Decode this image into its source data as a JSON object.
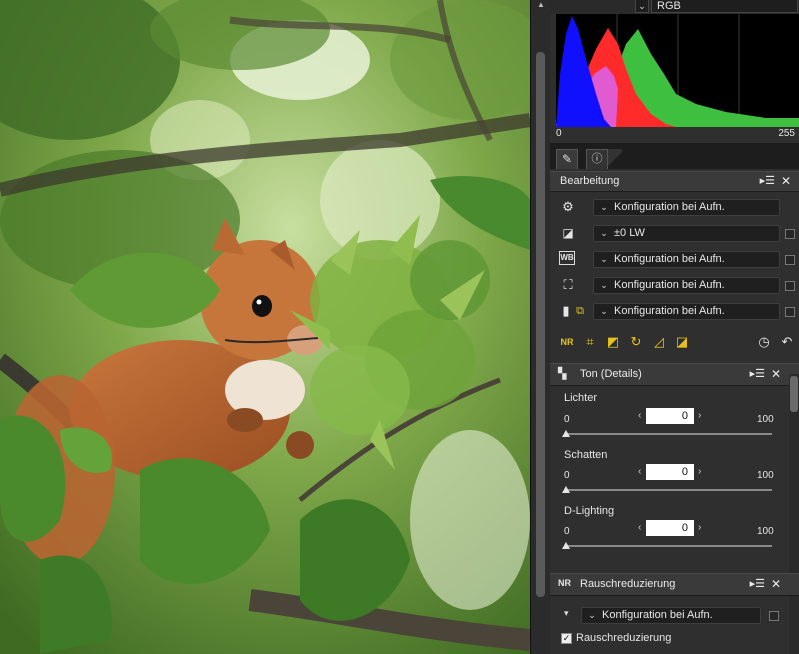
{
  "histogram": {
    "channel": "RGB",
    "axis_min": "0",
    "axis_max": "255",
    "colors": {
      "blue": "#1010ff",
      "red": "#ff2a2a",
      "magenta": "#e05ad0",
      "green": "#3fbf3f",
      "yellow": "#ffff10",
      "white": "#eeeeee"
    }
  },
  "tabs": [
    {
      "name": "edit-tab",
      "icon": "edit-icon"
    },
    {
      "name": "info-tab",
      "icon": "info-icon"
    }
  ],
  "edit_panel": {
    "title": "Bearbeitung",
    "menu_icon": "▸☰",
    "rows": [
      {
        "icon": "gear-icon",
        "glyph": "⚙",
        "value": "Konfiguration bei Aufn.",
        "checkbox": false
      },
      {
        "icon": "exposure-icon",
        "glyph": "◪",
        "value": "±0 LW",
        "checkbox": true
      },
      {
        "icon": "white-balance-icon",
        "glyph": "WB",
        "value": "Konfiguration bei Aufn.",
        "checkbox": true
      },
      {
        "icon": "picture-control-icon",
        "glyph": "⛶",
        "value": "Konfiguration bei Aufn.",
        "checkbox": true
      },
      {
        "icon": "active-d-lighting-icon",
        "glyph": "▮",
        "value": "Konfiguration bei Aufn.",
        "checkbox": true
      }
    ],
    "toolbar": [
      "noise-reduction-tool-icon",
      "crop-tool-icon",
      "straighten-tool-icon",
      "rotate-tool-icon",
      "perspective-tool-icon",
      "levels-tool-icon"
    ],
    "toolbar_glyphs": [
      "NR",
      "⌗",
      "◩",
      "↻",
      "◿",
      "◪"
    ],
    "history_icon": "history-icon",
    "undo_icon": "undo-icon"
  },
  "tone_panel": {
    "title": "Ton (Details)",
    "sliders": [
      {
        "label": "Lichter",
        "min": "0",
        "max": "100",
        "value": "0",
        "fraction": 0
      },
      {
        "label": "Schatten",
        "min": "0",
        "max": "100",
        "value": "0",
        "fraction": 0
      },
      {
        "label": "D-Lighting",
        "min": "0",
        "max": "100",
        "value": "0",
        "fraction": 0
      }
    ]
  },
  "noise_panel": {
    "title": "Rauschreduzierung",
    "value": "Konfiguration bei Aufn.",
    "checkbox_label": "Rauschreduzierung",
    "checkbox_checked": true
  },
  "ui_glyphs": {
    "chev": "⌄",
    "close": "✕",
    "lt": "‹",
    "gt": "›",
    "tri": "▾",
    "up": "▲"
  }
}
